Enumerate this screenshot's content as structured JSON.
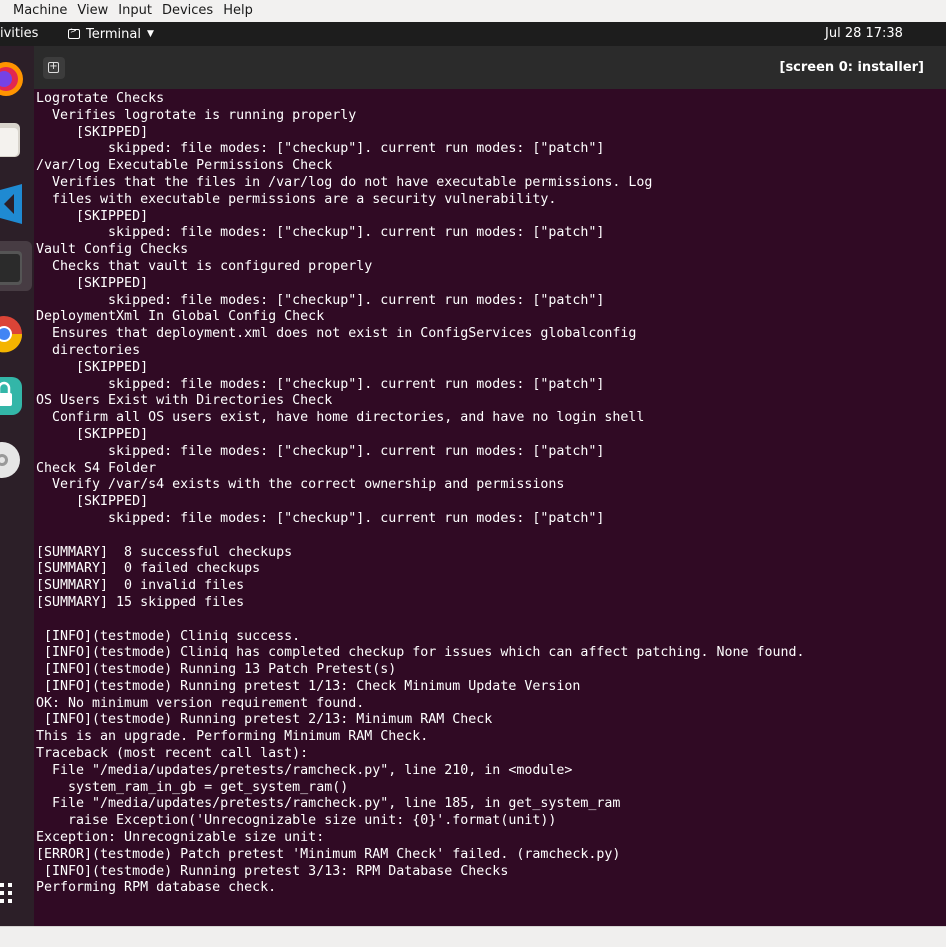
{
  "vm_menu": {
    "items": [
      "Machine",
      "View",
      "Input",
      "Devices",
      "Help"
    ]
  },
  "top_bar": {
    "activities_label": "ivities",
    "app_menu_label": "Terminal",
    "clock": "Jul 28  17:38"
  },
  "dock": {
    "apps": [
      {
        "name": "firefox-icon",
        "color": "#e66000"
      },
      {
        "name": "files-icon",
        "color": "#e8e4dc"
      },
      {
        "name": "vscode-icon",
        "color": "#1f8ad2"
      },
      {
        "name": "terminal-icon",
        "color": "#2e2e2e"
      },
      {
        "name": "chrome-icon",
        "color": "#4285f4"
      },
      {
        "name": "lock-icon",
        "color": "#33b6a8"
      },
      {
        "name": "disc-icon",
        "color": "#dddddd"
      }
    ],
    "show_apps_icon": "grid-icon"
  },
  "terminal": {
    "title": "[screen 0: installer]",
    "lines": [
      "Logrotate Checks",
      "  Verifies logrotate is running properly",
      "     [SKIPPED]",
      "         skipped: file modes: [\"checkup\"]. current run modes: [\"patch\"]",
      "/var/log Executable Permissions Check",
      "  Verifies that the files in /var/log do not have executable permissions. Log",
      "  files with executable permissions are a security vulnerability.",
      "     [SKIPPED]",
      "         skipped: file modes: [\"checkup\"]. current run modes: [\"patch\"]",
      "Vault Config Checks",
      "  Checks that vault is configured properly",
      "     [SKIPPED]",
      "         skipped: file modes: [\"checkup\"]. current run modes: [\"patch\"]",
      "DeploymentXml In Global Config Check",
      "  Ensures that deployment.xml does not exist in ConfigServices globalconfig",
      "  directories",
      "     [SKIPPED]",
      "         skipped: file modes: [\"checkup\"]. current run modes: [\"patch\"]",
      "OS Users Exist with Directories Check",
      "  Confirm all OS users exist, have home directories, and have no login shell",
      "     [SKIPPED]",
      "         skipped: file modes: [\"checkup\"]. current run modes: [\"patch\"]",
      "Check S4 Folder",
      "  Verify /var/s4 exists with the correct ownership and permissions",
      "     [SKIPPED]",
      "         skipped: file modes: [\"checkup\"]. current run modes: [\"patch\"]",
      "",
      "[SUMMARY]  8 successful checkups",
      "[SUMMARY]  0 failed checkups",
      "[SUMMARY]  0 invalid files",
      "[SUMMARY] 15 skipped files",
      "",
      " [INFO](testmode) Cliniq success.",
      " [INFO](testmode) Cliniq has completed checkup for issues which can affect patching. None found.",
      " [INFO](testmode) Running 13 Patch Pretest(s)",
      " [INFO](testmode) Running pretest 1/13: Check Minimum Update Version",
      "OK: No minimum version requirement found.",
      " [INFO](testmode) Running pretest 2/13: Minimum RAM Check",
      "This is an upgrade. Performing Minimum RAM Check.",
      "Traceback (most recent call last):",
      "  File \"/media/updates/pretests/ramcheck.py\", line 210, in <module>",
      "    system_ram_in_gb = get_system_ram()",
      "  File \"/media/updates/pretests/ramcheck.py\", line 185, in get_system_ram",
      "    raise Exception('Unrecognizable size unit: {0}'.format(unit))",
      "Exception: Unrecognizable size unit:",
      "[ERROR](testmode) Patch pretest 'Minimum RAM Check' failed. (ramcheck.py)",
      " [INFO](testmode) Running pretest 3/13: RPM Database Checks",
      "Performing RPM database check."
    ]
  }
}
